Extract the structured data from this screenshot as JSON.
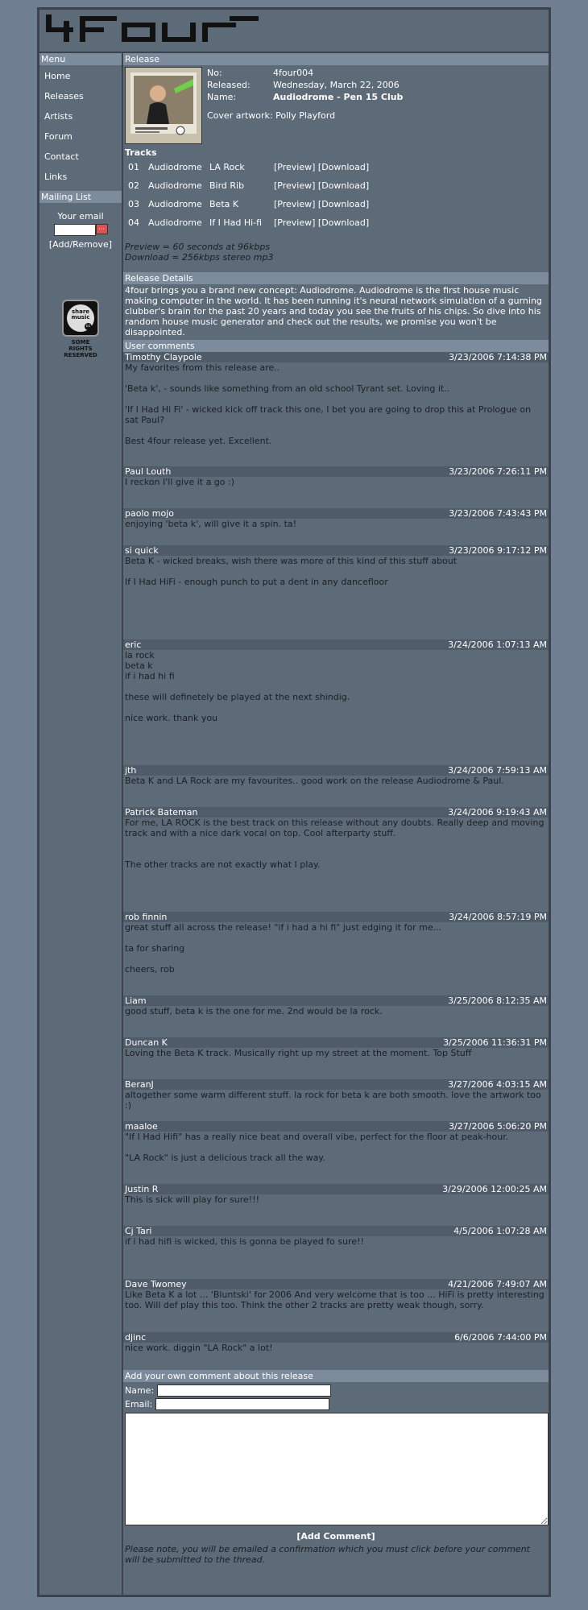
{
  "logo": {
    "text": "4four"
  },
  "sidebar": {
    "menu_title": "Menu",
    "items": [
      {
        "label": "Home"
      },
      {
        "label": "Releases"
      },
      {
        "label": "Artists"
      },
      {
        "label": "Forum"
      },
      {
        "label": "Contact"
      },
      {
        "label": "Links"
      }
    ],
    "mailing_title": "Mailing List",
    "email_label": "Your email",
    "add_remove": "[Add/Remove]",
    "cc_badge": {
      "line1": "share",
      "line2": "music",
      "footer": "SOME RIGHTS RESERVED"
    }
  },
  "release": {
    "section_title": "Release",
    "no_label": "No:",
    "no_value": "4four004",
    "released_label": "Released:",
    "released_value": "Wednesday, March 22, 2006",
    "name_label": "Name:",
    "name_value": "Audiodrome - Pen 15 Club",
    "cover_label": "Cover artwork:",
    "cover_value": "Polly Playford",
    "tracks_title": "Tracks",
    "tracks": [
      {
        "num": "01",
        "artist": "Audiodrome",
        "title": "LA Rock",
        "preview": "[Preview]",
        "download": "[Download]"
      },
      {
        "num": "02",
        "artist": "Audiodrome",
        "title": "Bird Rib",
        "preview": "[Preview]",
        "download": "[Download]"
      },
      {
        "num": "03",
        "artist": "Audiodrome",
        "title": "Beta K",
        "preview": "[Preview]",
        "download": "[Download]"
      },
      {
        "num": "04",
        "artist": "Audiodrome",
        "title": "If I Had Hi-fi",
        "preview": "[Preview]",
        "download": "[Download]"
      }
    ],
    "note_preview": "Preview = 60 seconds at 96kbps",
    "note_download": "Download = 256kbps stereo mp3"
  },
  "details": {
    "title": "Release Details",
    "text": "4four brings you a brand new concept: Audiodrome. Audiodrome is the first house music making computer in the world. It has been running it's neural network simulation of a gurning clubber's brain for the past 20 years and today you see the fruits of his chips. So dive into his random house music generator and check out the results, we promise you won't be disappointed."
  },
  "comments": {
    "title": "User comments",
    "items": [
      {
        "name": "Timothy Claypole",
        "date": "3/23/2006 7:14:38 PM",
        "text": "My favorites from this release are..\n\n'Beta k', - sounds like something from an old school Tyrant set. Loving it..\n\n'If I Had Hi Fi' - wicked kick off track this one, I bet you are going to drop this at Prologue on sat Paul?\n\nBest 4four release yet. Excellent."
      },
      {
        "name": "Paul Louth",
        "date": "3/23/2006 7:26:11 PM",
        "text": "I reckon I'll give it a go :)"
      },
      {
        "name": "paolo mojo",
        "date": "3/23/2006 7:43:43 PM",
        "text": "enjoying 'beta k', will give it a spin. ta!"
      },
      {
        "name": "si quick",
        "date": "3/23/2006 9:17:12 PM",
        "text": "Beta K - wicked breaks, wish there was more of this kind of this stuff about\n\nIf I Had HiFi - enough punch to put a dent in any dancefloor"
      },
      {
        "name": "eric",
        "date": "3/24/2006 1:07:13 AM",
        "text": "la rock\nbeta k\nif i had hi fi\n\nthese will definetely be played at the next shindig.\n\nnice work. thank you"
      },
      {
        "name": "jth",
        "date": "3/24/2006 7:59:13 AM",
        "text": "Beta K and LA Rock are my favourites.. good work on the release Audiodrome & Paul."
      },
      {
        "name": "Patrick Bateman",
        "date": "3/24/2006 9:19:43 AM",
        "text": "For me, LA ROCK is the best track on this release without any doubts. Really deep and moving track and with a nice dark vocal on top. Cool afterparty stuff.\n\n\nThe other tracks are not exactly what I play."
      },
      {
        "name": "rob finnin",
        "date": "3/24/2006 8:57:19 PM",
        "text": "great stuff all across the release! \"if i had a hi fi\" just edging it for me...\n\nta for sharing\n\ncheers, rob"
      },
      {
        "name": "Liam",
        "date": "3/25/2006 8:12:35 AM",
        "text": "good stuff, beta k is the one for me. 2nd would be la rock."
      },
      {
        "name": "Duncan K",
        "date": "3/25/2006 11:36:31 PM",
        "text": "Loving the Beta K track. Musically right up my street at the moment. Top Stuff"
      },
      {
        "name": "BeranJ",
        "date": "3/27/2006 4:03:15 AM",
        "text": "altogether some warm different stuff. la rock for beta k are both smooth. love the artwork too :)"
      },
      {
        "name": "maaloe",
        "date": "3/27/2006 5:06:20 PM",
        "text": "\"If I Had Hifi\" has a really nice beat and overall vibe, perfect for the floor at peak-hour.\n\n\"LA Rock\" is just a delicious track all the way."
      },
      {
        "name": "Justin R",
        "date": "3/29/2006 12:00:25 AM",
        "text": "This is sick will play for sure!!!"
      },
      {
        "name": "Cj Tari",
        "date": "4/5/2006 1:07:28 AM",
        "text": "if i had hifi is wicked, this is gonna be played fo sure!!"
      },
      {
        "name": "Dave Twomey",
        "date": "4/21/2006 7:49:07 AM",
        "text": "Like Beta K a lot ... 'Bluntski' for 2006 And very welcome that is too ... HiFi is pretty interesting too. Will def play this too. Think the other 2 tracks are pretty weak though, sorry."
      },
      {
        "name": "djinc",
        "date": "6/6/2006 7:44:00 PM",
        "text": "nice work. diggin \"LA Rock\" a lot!"
      }
    ]
  },
  "form": {
    "title": "Add your own comment about this release",
    "name_label": "Name:",
    "email_label": "Email:",
    "submit": "[Add Comment]",
    "note": "Please note, you will be emailed a confirmation which you must click before your comment will be submitted to the thread."
  },
  "colors": {
    "background": "#6f7f91",
    "panel": "#5d6a78",
    "header_bar": "#7d8c9c",
    "comment_head": "#4f5b68"
  }
}
